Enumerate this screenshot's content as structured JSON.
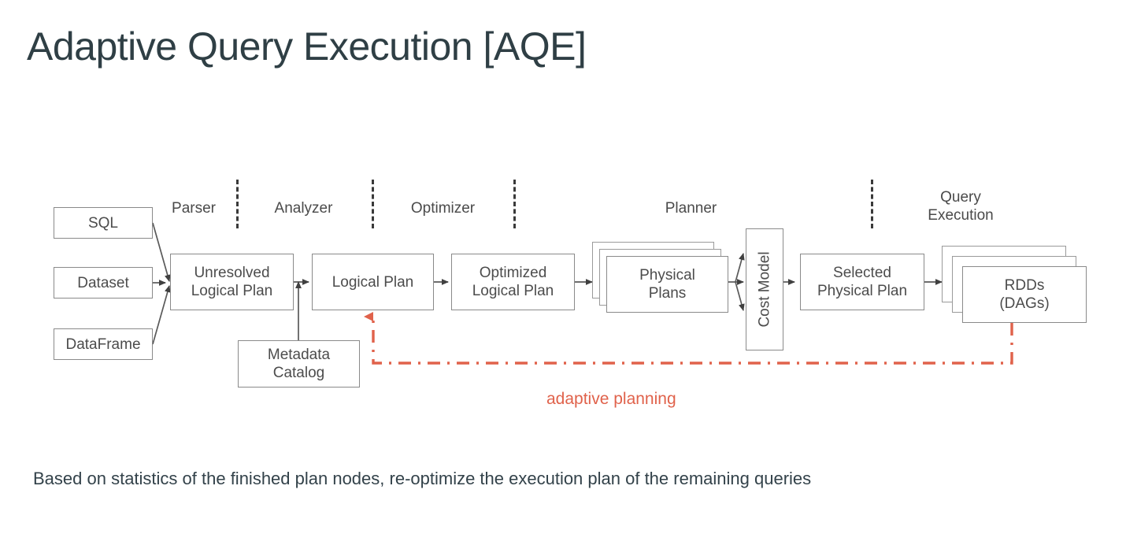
{
  "slide": {
    "title": "Adaptive Query Execution [AQE]",
    "caption": "Based on statistics of the finished plan nodes, re-optimize the execution plan of the remaining queries",
    "background_color": "#ffffff",
    "title_color": "#2f3f45",
    "caption_color": "#33424a"
  },
  "diagram": {
    "accent_color": "#e0624b",
    "box_border_color": "#8a8a8a",
    "box_text_color": "#4c4c4c",
    "stage_label_color": "#4a4a4a",
    "stages": [
      {
        "label": "Parser"
      },
      {
        "label": "Analyzer"
      },
      {
        "label": "Optimizer"
      },
      {
        "label": "Planner"
      },
      {
        "label": "Query\nExecution"
      }
    ],
    "inputs": [
      {
        "label": "SQL"
      },
      {
        "label": "Dataset"
      },
      {
        "label": "DataFrame"
      }
    ],
    "nodes": [
      {
        "id": "unresolved-logical-plan",
        "label": "Unresolved\nLogical Plan"
      },
      {
        "id": "logical-plan",
        "label": "Logical Plan"
      },
      {
        "id": "metadata-catalog",
        "label": "Metadata\nCatalog"
      },
      {
        "id": "optimized-logical-plan",
        "label": "Optimized\nLogical Plan"
      },
      {
        "id": "physical-plans",
        "label": "Physical\nPlans"
      },
      {
        "id": "cost-model",
        "label": "Cost Model"
      },
      {
        "id": "selected-physical-plan",
        "label": "Selected\nPhysical Plan"
      },
      {
        "id": "rdds",
        "label": "RDDs\n(DAGs)"
      }
    ],
    "feedback": {
      "label": "adaptive planning",
      "style": "dash-dot",
      "from": "rdds",
      "to": "logical-plan"
    }
  }
}
